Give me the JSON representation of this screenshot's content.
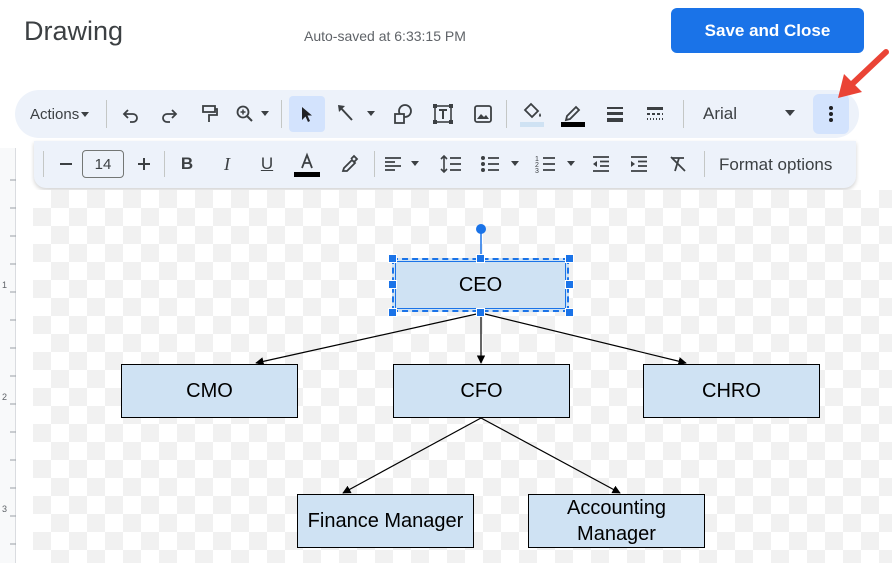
{
  "header": {
    "title": "Drawing",
    "autosave": "Auto-saved at 6:33:15 PM",
    "save_button": "Save and Close"
  },
  "toolbar": {
    "actions_label": "Actions",
    "font_name": "Arial",
    "font_size": "14",
    "format_options": "Format options",
    "icons": [
      "undo-icon",
      "redo-icon",
      "paint-format-icon",
      "zoom-icon",
      "select-icon",
      "line-icon",
      "shape-icon",
      "text-box-icon",
      "image-icon",
      "fill-color-icon",
      "border-color-icon",
      "border-weight-icon",
      "border-dash-icon",
      "more-options-icon",
      "decrease-size-icon",
      "increase-size-icon",
      "bold-icon",
      "italic-icon",
      "underline-icon",
      "text-color-icon",
      "highlight-icon",
      "align-icon",
      "line-spacing-icon",
      "bulleted-list-icon",
      "numbered-list-icon",
      "decrease-indent-icon",
      "increase-indent-icon",
      "clear-formatting-icon"
    ]
  },
  "diagram": {
    "nodes": {
      "ceo": "CEO",
      "cmo": "CMO",
      "cfo": "CFO",
      "chro": "CHRO",
      "finance_manager": "Finance Manager",
      "accounting_manager": "Accounting Manager"
    },
    "edges": [
      [
        "ceo",
        "cmo"
      ],
      [
        "ceo",
        "cfo"
      ],
      [
        "ceo",
        "chro"
      ],
      [
        "cfo",
        "finance_manager"
      ],
      [
        "cfo",
        "accounting_manager"
      ]
    ],
    "selected": "ceo",
    "box_fill": "#cfe2f3"
  },
  "ruler": {
    "labels": [
      "1",
      "2",
      "3"
    ]
  },
  "colors": {
    "accent": "#1a73e8",
    "annotation_arrow": "#ea4335",
    "toolbar_bg": "#edf2fa"
  }
}
